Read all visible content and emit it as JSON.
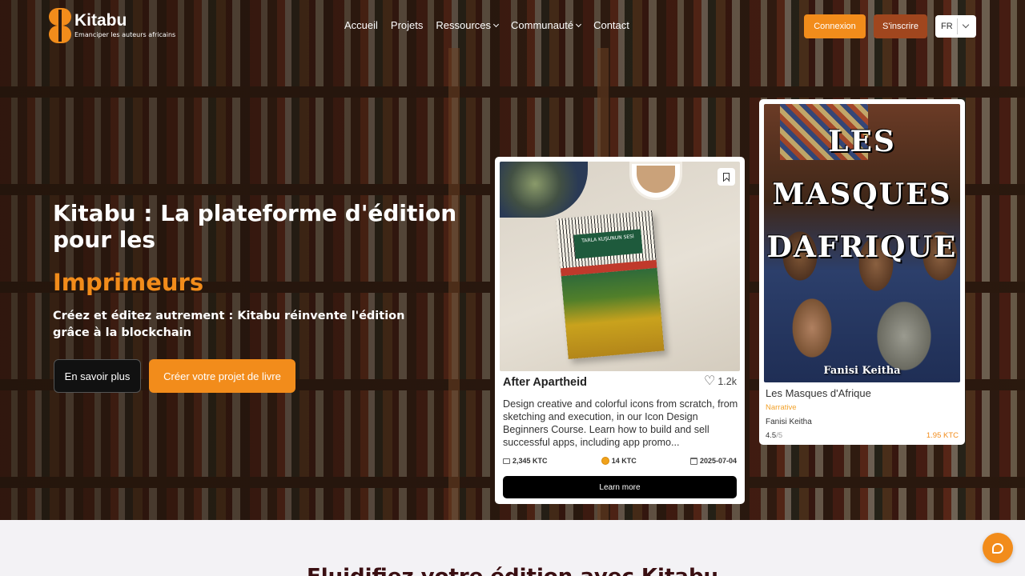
{
  "brand": {
    "name": "Kitabu",
    "tagline": "Emanciper les auteurs africains"
  },
  "nav": {
    "items": [
      {
        "label": "Accueil",
        "dropdown": false
      },
      {
        "label": "Projets",
        "dropdown": false
      },
      {
        "label": "Ressources",
        "dropdown": true
      },
      {
        "label": "Communauté",
        "dropdown": true
      },
      {
        "label": "Contact",
        "dropdown": false
      }
    ],
    "login_label": "Connexion",
    "signup_label": "S'inscrire",
    "language": "FR"
  },
  "hero": {
    "title": "Kitabu : La plateforme d'édition pour les",
    "accent": "Imprimeurs",
    "subtitle": "Créez et éditez autrement : Kitabu réinvente l'édition grâce à la blockchain",
    "learn_more_label": "En savoir plus",
    "create_label": "Créer votre projet de livre"
  },
  "project_card": {
    "book_label": "TARLA KUŞUNUN SESİ",
    "title": "After Apartheid",
    "likes": "1.2k",
    "description": "Design creative and colorful icons from scratch, from sketching and execution, in our Icon Design Beginners Course. Learn how to build and sell successful apps, including app promo...",
    "funding": "2,345 KTC",
    "token_price": "14 KTC",
    "date": "2025-07-04",
    "cta_label": "Learn more"
  },
  "book_card": {
    "cover_title": "LES MASQUES DAFRIQUE",
    "cover_author": "Fanisi Keitha",
    "title": "Les Masques d'Afrique",
    "genre": "Narrative",
    "author": "Fanisi Keitha",
    "rating": "4.5",
    "rating_max": "/5",
    "price": "1.95 KTC"
  },
  "section": {
    "title": "Fluidifiez votre édition avec Kitabu"
  },
  "colors": {
    "accent": "#f28c1b",
    "signup": "#a0461e",
    "dark": "#111111"
  },
  "icons": [
    "logo-icon",
    "chevron-down-icon",
    "bookmark-icon",
    "heart-icon",
    "money-icon",
    "coin-icon",
    "calendar-icon",
    "chat-icon"
  ]
}
